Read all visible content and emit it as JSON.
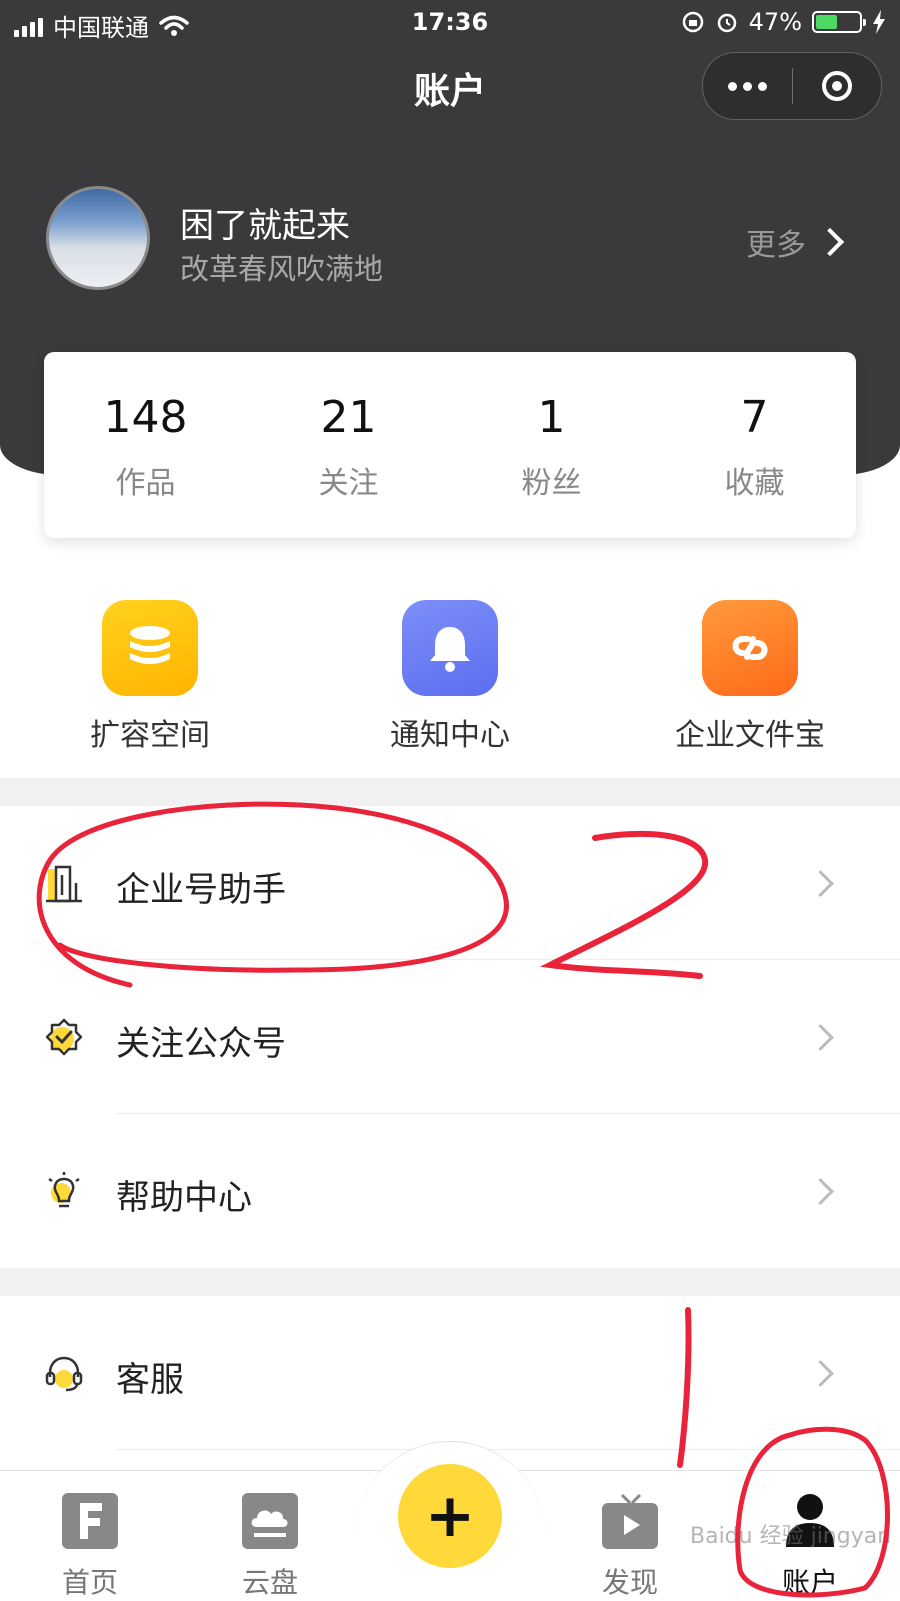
{
  "status_bar": {
    "carrier": "中国联通",
    "time": "17:36",
    "battery": "47%"
  },
  "title_bar": {
    "title": "账户"
  },
  "profile": {
    "name": "困了就起来",
    "signature": "改革春风吹满地",
    "more_label": "更多"
  },
  "stats": [
    {
      "value": "148",
      "label": "作品"
    },
    {
      "value": "21",
      "label": "关注"
    },
    {
      "value": "1",
      "label": "粉丝"
    },
    {
      "value": "7",
      "label": "收藏"
    }
  ],
  "quick_actions": [
    {
      "label": "扩容空间",
      "icon": "storage-icon",
      "color": "#ffc20e"
    },
    {
      "label": "通知中心",
      "icon": "bell-icon",
      "color": "#6a7cf3"
    },
    {
      "label": "企业文件宝",
      "icon": "link-icon",
      "color": "#ff7e2b"
    }
  ],
  "menu": [
    {
      "label": "企业号助手",
      "icon": "building-icon"
    },
    {
      "label": "关注公众号",
      "icon": "badge-check-icon"
    },
    {
      "label": "帮助中心",
      "icon": "lightbulb-icon"
    },
    {
      "label": "客服",
      "icon": "headset-icon"
    }
  ],
  "tabs": [
    {
      "label": "首页",
      "icon": "home-f-icon"
    },
    {
      "label": "云盘",
      "icon": "cloud-drive-icon"
    },
    {
      "label": "发现",
      "icon": "tv-play-icon"
    },
    {
      "label": "账户",
      "icon": "person-icon",
      "active": true
    }
  ],
  "annotations": {
    "number_1": "1",
    "number_2": "2",
    "color": "#e8233a"
  },
  "watermark": "Baidu 经验 jingyan.baidu.com"
}
